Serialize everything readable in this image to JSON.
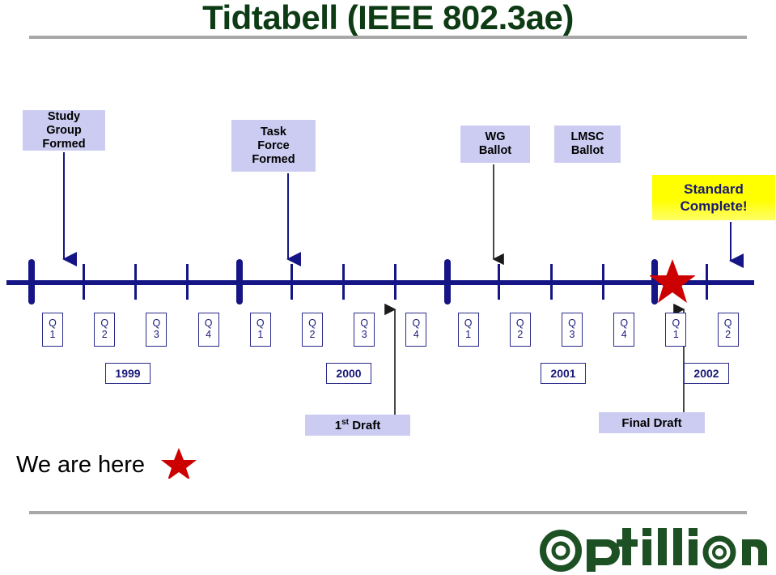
{
  "slide": {
    "title": "Tidtabell (IEEE 802.3ae)",
    "footer_logo_text": "optillion"
  },
  "colors": {
    "title_green": "#0d3b14",
    "timeline_navy": "#151585",
    "milestone_box": "#ccccf2",
    "highlight_yellow": "#ffff00",
    "highlight_text": "#1a1a6e",
    "star_red": "#cc0000",
    "rule_gray": "#a8a8a8"
  },
  "milestones": [
    {
      "id": "study-group",
      "lines": [
        "Study",
        "Group",
        "Formed"
      ]
    },
    {
      "id": "task-force",
      "lines": [
        "Task",
        "Force",
        "Formed"
      ]
    },
    {
      "id": "wg-ballot",
      "lines": [
        "WG",
        "Ballot"
      ]
    },
    {
      "id": "lmsc-ballot",
      "lines": [
        "LMSC",
        "Ballot"
      ]
    },
    {
      "id": "standard-complete",
      "lines": [
        "Standard",
        "Complete!"
      ]
    }
  ],
  "drafts": [
    {
      "id": "first-draft",
      "label": "1",
      "sup": "st",
      "rest": " Draft"
    },
    {
      "id": "final-draft",
      "label": "Final Draft"
    }
  ],
  "timeline": {
    "quarters": [
      {
        "q": "Q",
        "n": "1"
      },
      {
        "q": "Q",
        "n": "2"
      },
      {
        "q": "Q",
        "n": "3"
      },
      {
        "q": "Q",
        "n": "4"
      },
      {
        "q": "Q",
        "n": "1"
      },
      {
        "q": "Q",
        "n": "2"
      },
      {
        "q": "Q",
        "n": "3"
      },
      {
        "q": "Q",
        "n": "4"
      },
      {
        "q": "Q",
        "n": "1"
      },
      {
        "q": "Q",
        "n": "2"
      },
      {
        "q": "Q",
        "n": "3"
      },
      {
        "q": "Q",
        "n": "4"
      },
      {
        "q": "Q",
        "n": "1"
      },
      {
        "q": "Q",
        "n": "2"
      }
    ],
    "years": [
      "1999",
      "2000",
      "2001",
      "2002"
    ]
  },
  "annotation": {
    "we_are_here": "We are here"
  },
  "chart_data": {
    "type": "timeline",
    "title": "Tidtabell (IEEE 802.3ae)",
    "x_unit": "quarter",
    "categories": [
      "Q1 1999",
      "Q2 1999",
      "Q3 1999",
      "Q4 1999",
      "Q1 2000",
      "Q2 2000",
      "Q3 2000",
      "Q4 2000",
      "Q1 2001",
      "Q2 2001",
      "Q3 2001",
      "Q4 2001",
      "Q1 2002",
      "Q2 2002"
    ],
    "year_boundaries": [
      "1999",
      "2000",
      "2001",
      "2002"
    ],
    "events": [
      {
        "label": "Study Group Formed",
        "at": "Q2 1999",
        "direction": "down"
      },
      {
        "label": "Task Force Formed",
        "at": "Q2 2000",
        "direction": "down"
      },
      {
        "label": "1st Draft",
        "at": "Q4 2000",
        "direction": "up"
      },
      {
        "label": "WG Ballot",
        "at": "Q2 2001",
        "direction": "down"
      },
      {
        "label": "Final Draft",
        "at": "Q1 2002",
        "direction": "up"
      },
      {
        "label": "LMSC Ballot",
        "at": "Q1 2002",
        "direction": "down"
      },
      {
        "label": "Standard Complete!",
        "at": "Q2 2002",
        "direction": "down"
      }
    ],
    "current_marker": {
      "label": "We are here",
      "at": "Q4 2001",
      "symbol": "star",
      "color": "#cc0000"
    }
  }
}
